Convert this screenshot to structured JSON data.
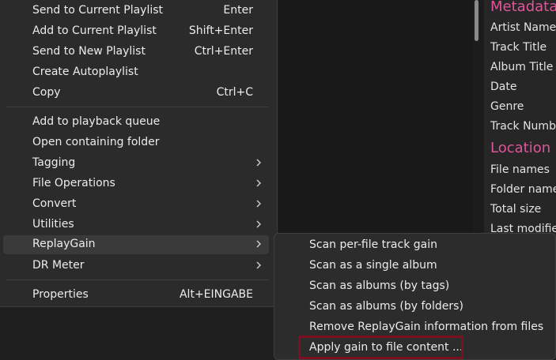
{
  "menu": {
    "items": [
      {
        "label": "Send to Current Playlist",
        "shortcut": "Enter"
      },
      {
        "label": "Add to Current Playlist",
        "shortcut": "Shift+Enter"
      },
      {
        "label": "Send to New Playlist",
        "shortcut": "Ctrl+Enter"
      },
      {
        "label": "Create Autoplaylist",
        "shortcut": ""
      },
      {
        "label": "Copy",
        "shortcut": "Ctrl+C"
      },
      {
        "label": "Add to playback queue",
        "shortcut": ""
      },
      {
        "label": "Open containing folder",
        "shortcut": ""
      },
      {
        "label": "Tagging",
        "submenu": true
      },
      {
        "label": "File Operations",
        "submenu": true
      },
      {
        "label": "Convert",
        "submenu": true
      },
      {
        "label": "Utilities",
        "submenu": true
      },
      {
        "label": "ReplayGain",
        "submenu": true,
        "active": true
      },
      {
        "label": "DR Meter",
        "submenu": true
      },
      {
        "label": "Properties",
        "shortcut": "Alt+EINGABE"
      }
    ]
  },
  "submenu": {
    "items": [
      {
        "label": "Scan per-file track gain"
      },
      {
        "label": "Scan as a single album"
      },
      {
        "label": "Scan as albums (by tags)"
      },
      {
        "label": "Scan as albums (by folders)"
      },
      {
        "label": "Remove ReplayGain information from files"
      },
      {
        "label": "Apply gain to file content ...",
        "highlighted": true
      }
    ]
  },
  "properties": {
    "section_metadata": "Metadata",
    "metadata_rows": [
      "Artist Name",
      "Track Title",
      "Album Title",
      "Date",
      "Genre",
      "Track Number"
    ],
    "section_location": "Location",
    "location_rows": [
      "File names",
      "Folder name",
      "Total size",
      "Last modified"
    ]
  },
  "colors": {
    "section_heading": "#e0559a",
    "highlight_border": "#7a1020"
  },
  "icons": {
    "submenu_arrow": "chevron-right-icon"
  }
}
